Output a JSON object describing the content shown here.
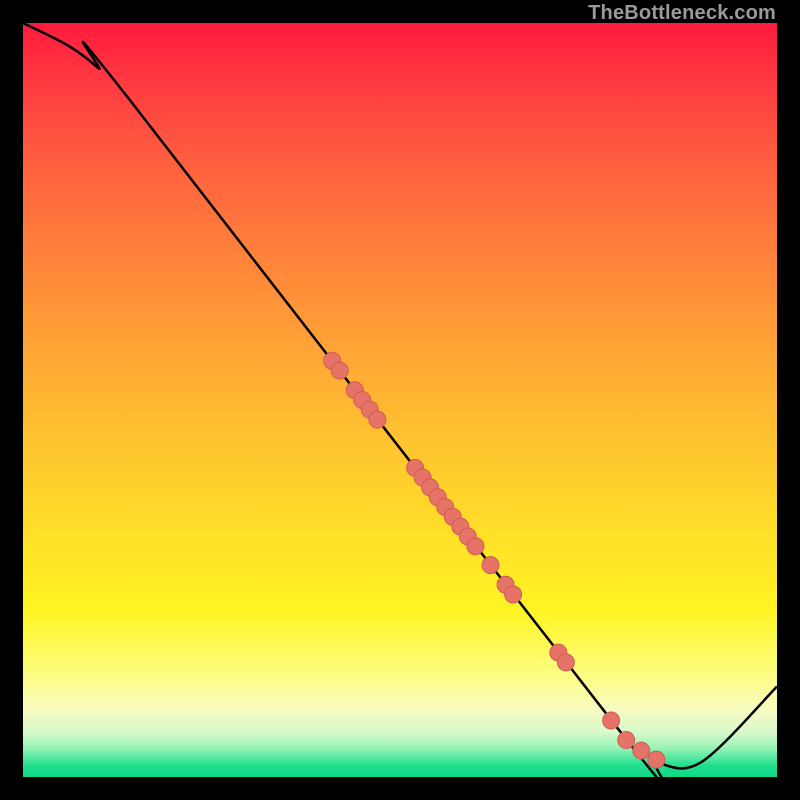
{
  "watermark": "TheBottleneck.com",
  "colors": {
    "dot_fill": "#e57368",
    "dot_stroke": "#d25c52",
    "line": "#000000"
  },
  "chart_data": {
    "type": "line",
    "title": "",
    "xlabel": "",
    "ylabel": "",
    "xlim": [
      0,
      100
    ],
    "ylim": [
      0,
      100
    ],
    "curve": {
      "x": [
        0,
        6,
        10,
        14,
        80,
        84,
        90,
        100
      ],
      "y": [
        100,
        97,
        94,
        90,
        5,
        2,
        2,
        12
      ]
    },
    "series": [
      {
        "name": "points",
        "x": [
          41,
          42,
          44,
          45,
          46,
          47,
          52,
          53,
          54,
          55,
          56,
          57,
          58,
          59,
          60,
          62,
          64,
          65,
          71,
          72,
          78,
          80,
          82,
          84
        ],
        "y": [
          55.2,
          53.9,
          51.3,
          50.0,
          48.7,
          47.4,
          41.0,
          39.7,
          38.4,
          37.1,
          35.8,
          34.5,
          33.2,
          31.9,
          30.6,
          28.1,
          25.5,
          24.2,
          16.5,
          15.2,
          7.5,
          4.9,
          3.5,
          2.3
        ]
      }
    ]
  }
}
